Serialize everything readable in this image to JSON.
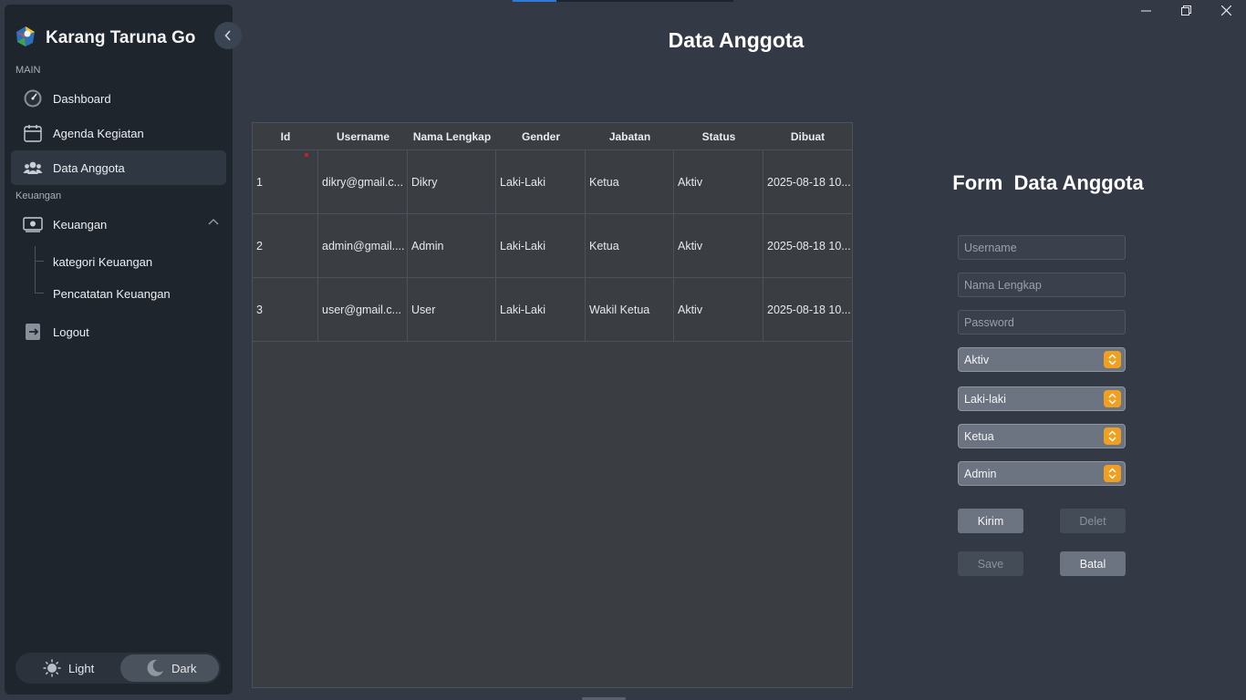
{
  "app": {
    "title": "Karang Taruna Go",
    "colors": {
      "background": "#333a45",
      "sidebar": "#1f252d",
      "accent": "#f0a020",
      "progress": "#2f7ad6",
      "sort_indicator": "#d02020"
    }
  },
  "window_controls": {
    "minimize_icon": "minimize-icon",
    "maximize_icon": "restore-icon",
    "close_icon": "close-icon"
  },
  "sidebar": {
    "sections": {
      "main": "MAIN",
      "finance": "Keuangan"
    },
    "items": [
      {
        "label": "Dashboard",
        "icon": "speedometer-icon"
      },
      {
        "label": "Agenda Kegiatan",
        "icon": "calendar-icon"
      },
      {
        "label": "Data Anggota",
        "icon": "users-icon",
        "active": true
      },
      {
        "label": "Keuangan",
        "icon": "money-icon",
        "expanded": true
      }
    ],
    "sub_items": [
      {
        "label": "kategori Keuangan"
      },
      {
        "label": "Pencatatan Keuangan"
      }
    ],
    "logout": {
      "label": "Logout",
      "icon": "logout-icon"
    },
    "theme": {
      "light": "Light",
      "dark": "Dark",
      "selected": "Dark"
    }
  },
  "page": {
    "title": "Data Anggota"
  },
  "table": {
    "columns": [
      "Id",
      "Username",
      "Nama Lengkap",
      "Gender",
      "Jabatan",
      "Status",
      "Dibuat"
    ],
    "rows": [
      [
        "1",
        "dikry@gmail.c...",
        "Dikry",
        "Laki-Laki",
        "Ketua",
        "Aktiv",
        "2025-08-18 10..."
      ],
      [
        "2",
        "admin@gmail....",
        "Admin",
        "Laki-Laki",
        "Ketua",
        "Aktiv",
        "2025-08-18 10..."
      ],
      [
        "3",
        "user@gmail.c...",
        "User",
        "Laki-Laki",
        "Wakil Ketua",
        "Aktiv",
        "2025-08-18 10..."
      ]
    ]
  },
  "form": {
    "title": "Form  Data Anggota",
    "username_placeholder": "Username",
    "fullname_placeholder": "Nama Lengkap",
    "password_placeholder": "Password",
    "status_value": "Aktiv",
    "gender_value": "Laki-laki",
    "position_value": "Ketua",
    "role_value": "Admin",
    "buttons": {
      "submit": "Kirim",
      "delete": "Delet",
      "save": "Save",
      "cancel": "Batal"
    }
  }
}
